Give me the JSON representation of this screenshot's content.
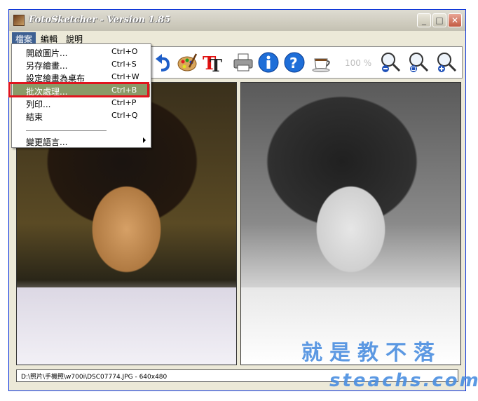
{
  "window": {
    "title": "FotoSketcher - Version 1.85"
  },
  "menubar": {
    "items": [
      "檔案",
      "編輯",
      "說明"
    ]
  },
  "file_menu": {
    "items": [
      {
        "label": "開啟圖片...",
        "shortcut": "Ctrl+O"
      },
      {
        "label": "另存繪畫...",
        "shortcut": "Ctrl+S"
      },
      {
        "label": "設定繪畫為桌布",
        "shortcut": "Ctrl+W"
      },
      {
        "label": "批次處理...",
        "shortcut": "Ctrl+B"
      },
      {
        "label": "列印...",
        "shortcut": "Ctrl+P"
      },
      {
        "label": "結束",
        "shortcut": "Ctrl+Q"
      }
    ],
    "language_label": "變更語言..."
  },
  "toolbar": {
    "zoom_level": "100 %"
  },
  "statusbar": {
    "text": "D:\\照片\\手機照\\w700i\\DSC07774.JPG - 640x480"
  },
  "watermark": {
    "line1": "就是教不落",
    "line2": "steachs.com"
  },
  "colors": {
    "menu_highlight": "#8a9a68",
    "highlight_border": "#e0141e",
    "watermark": "#4a8ee0"
  }
}
